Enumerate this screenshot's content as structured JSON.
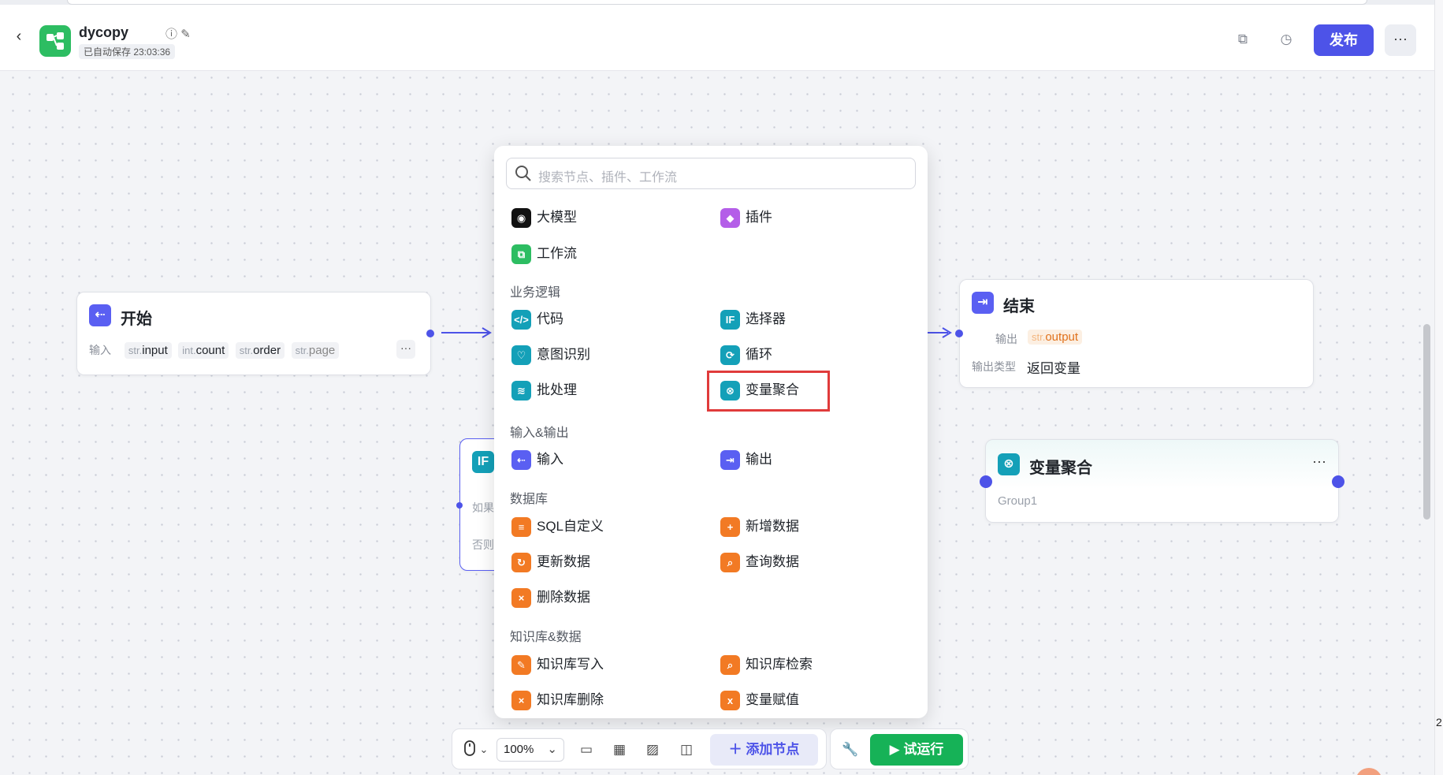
{
  "header": {
    "app_name": "dycopy",
    "saved_text": "已自动保存 23:03:36",
    "publish_label": "发布"
  },
  "nodes": {
    "start": {
      "title": "开始",
      "input_label": "输入",
      "inputs": [
        {
          "type": "str.",
          "name": "input"
        },
        {
          "type": "int.",
          "name": "count"
        },
        {
          "type": "str.",
          "name": "order"
        },
        {
          "type": "str.",
          "name": "page"
        }
      ]
    },
    "end": {
      "title": "结束",
      "output_label": "输出",
      "output_type": "str.",
      "output_name": "output",
      "output_kind_label": "输出类型",
      "output_kind_value": "返回变量"
    },
    "aggregator": {
      "title": "变量聚合",
      "group": "Group1"
    },
    "selector": {
      "icon_text": "IF",
      "if_text": "如果",
      "else_text": "否则"
    }
  },
  "panel": {
    "search_placeholder": "搜索节点、插件、工作流",
    "top_items": {
      "llm": "大模型",
      "plugin": "插件",
      "workflow": "工作流"
    },
    "sections": {
      "business": {
        "title": "业务逻辑",
        "code": "代码",
        "selector": "选择器",
        "intent": "意图识别",
        "loop": "循环",
        "batch": "批处理",
        "var_agg": "变量聚合"
      },
      "io": {
        "title": "输入&输出",
        "input": "输入",
        "output": "输出"
      },
      "db": {
        "title": "数据库",
        "sql": "SQL自定义",
        "insert": "新增数据",
        "update": "更新数据",
        "query": "查询数据",
        "delete": "删除数据"
      },
      "kb": {
        "title": "知识库&数据",
        "kb_write": "知识库写入",
        "kb_search": "知识库检索",
        "kb_delete": "知识库删除",
        "var_assign": "变量赋值"
      }
    }
  },
  "toolbar": {
    "zoom": "100%",
    "add_node": "添加节点",
    "run": "试运行"
  },
  "edge_number": "2",
  "colors": {
    "accent": "#4d53e8",
    "success": "#16b257",
    "highlight": "#e03b3b"
  }
}
